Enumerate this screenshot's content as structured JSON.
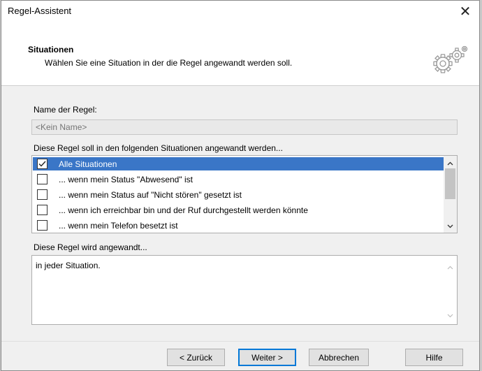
{
  "window": {
    "title": "Regel-Assistent",
    "close_glyph": "✕"
  },
  "header": {
    "title": "Situationen",
    "description": "Wählen Sie eine Situation in der die Regel angewandt werden soll.",
    "icon": "gears-icon"
  },
  "rule_name": {
    "label": "Name der Regel:",
    "placeholder": "<Kein Name>"
  },
  "situations": {
    "label": "Diese Regel soll in den folgenden Situationen angewandt werden...",
    "items": [
      {
        "label": "Alle Situationen",
        "checked": true,
        "selected": true
      },
      {
        "label": "... wenn mein Status \"Abwesend\" ist",
        "checked": false,
        "selected": false
      },
      {
        "label": "... wenn mein Status auf \"Nicht stören\" gesetzt ist",
        "checked": false,
        "selected": false
      },
      {
        "label": "... wenn ich erreichbar bin und der Ruf durchgestellt werden könnte",
        "checked": false,
        "selected": false
      },
      {
        "label": "... wenn mein Telefon besetzt ist",
        "checked": false,
        "selected": false
      }
    ]
  },
  "applied": {
    "label": "Diese Regel wird angewandt...",
    "text": "in jeder Situation."
  },
  "buttons": {
    "back": "< Zurück",
    "next": "Weiter >",
    "cancel": "Abbrechen",
    "help": "Hilfe"
  },
  "colors": {
    "selection": "#3a76c7",
    "default_button_border": "#0078d7"
  }
}
